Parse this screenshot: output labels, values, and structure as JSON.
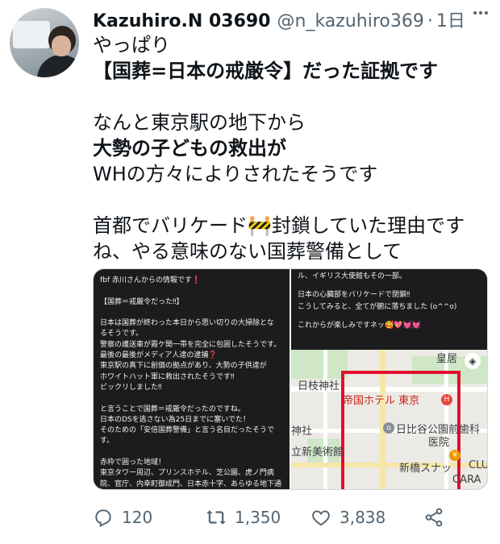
{
  "tweet": {
    "display_name": "Kazuhiro.N 03690",
    "handle": "@n_kazuhiro369",
    "separator": "·",
    "time": "1日",
    "lines": [
      "やっぱり",
      "【国葬=日本の戒厳令】だった証拠です",
      "",
      "なんと東京駅の地下から",
      "大勢の子どもの救出が",
      "WHの方々によりされたそうです",
      "",
      "首都でバリケード🚧封鎖していた理由です",
      "ね、やる意味のない国葬警備として"
    ]
  },
  "media": {
    "left_lines": [
      "fbf 赤川さんからの情報です❗",
      "",
      "【国葬＝戒厳令だった‼】",
      "",
      "日本は国葬が終わった本日から思い切りの大掃除とな",
      "るそうです。",
      "警察の護送車が霞ケ関一帯を完全に包囲したそうです。",
      " 最後の最後がメディア人達の逮捕❓",
      " 東京駅の真下に創価の拠点があり、大勢の子供達が",
      "ホワイトハット軍に救出されたそうです‼",
      "ビックリしました‼",
      "",
      "と言うことで国葬＝戒厳令だったのですね。",
      "日本のDSを逃さない為25日までに塞いでた！",
      "そのための「安倍国葬警備」と言う名目だったそうで",
      "す。",
      "",
      "赤枠で囲った地域！",
      "東京タワー周辺、プリンスホテル、芝公園、虎ノ門病",
      "院、官庁、内幸町御成門、日本赤十字、あらゆる地下通"
    ],
    "right_lines": [
      "ル、イギリス大使館もその一部。",
      "",
      "日本の心臓部をバリケードで閉鎖‼",
      "こうしてみると、全てが腑に落ちました (o^^o)",
      "",
      "これからが楽しみですネッ🥰💖💓💓"
    ],
    "map_labels": {
      "hibiya_shrine": "日枝神社",
      "imperial_hotel": "帝国ホテル 東京",
      "hibiya_clinic": "日比谷公園前歯科",
      "clinic": "医院",
      "shrine": "神社",
      "museum": "立新美術館",
      "shinbashi": "新橋スナッ",
      "club": "CLU",
      "cara": "CARA",
      "palace": "皇居"
    }
  },
  "actions": {
    "reply_count": "120",
    "retweet_count": "1,350",
    "like_count": "3,838"
  },
  "icons": {
    "reply": "reply-icon",
    "retweet": "retweet-icon",
    "like": "heart-icon",
    "share": "share-icon",
    "more": "more-icon"
  }
}
